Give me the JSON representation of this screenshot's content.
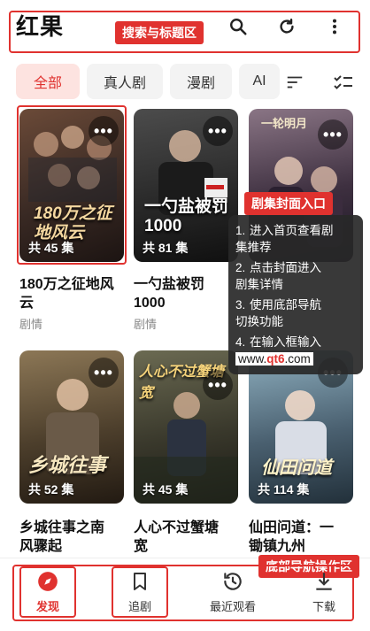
{
  "header": {
    "title": "红果",
    "icons": [
      "search-icon",
      "refresh-icon",
      "more-vertical-icon"
    ],
    "annotation_label": "搜索与标题区"
  },
  "tabs": [
    {
      "label": "全部",
      "active": true
    },
    {
      "label": "真人剧",
      "active": false
    },
    {
      "label": "漫剧",
      "active": false
    },
    {
      "label": "AI",
      "active": false
    }
  ],
  "tab_tools": [
    "sort-icon",
    "multi-select-icon"
  ],
  "cards": [
    {
      "title_line1": "180万之征地风",
      "title_line2": "云",
      "genre": "剧情",
      "episodes": "共 45 集",
      "cover_text": "180万之征地风云",
      "cover_colors": [
        "#5a3b2e",
        "#2a1d1a"
      ],
      "more": "•••"
    },
    {
      "title_line1": "一勺盐被罚",
      "title_line2": "1000",
      "genre": "剧情",
      "episodes": "共 81 集",
      "cover_text": "一勺盐被罚1000",
      "cover_colors": [
        "#3a3a3a",
        "#141414"
      ],
      "more": "•••"
    },
    {
      "title_line1": "",
      "title_line2": "",
      "genre": "",
      "episodes": "",
      "cover_text": "一轮明月",
      "cover_colors": [
        "#6b5a6a",
        "#1d1724"
      ],
      "more": "•••"
    },
    {
      "title_line1": "乡城往事之南",
      "title_line2": "风骤起",
      "genre": "",
      "episodes": "共 52 集",
      "cover_text": "乡城往事",
      "cover_colors": [
        "#7a6a4e",
        "#2d2418"
      ],
      "more": "•••"
    },
    {
      "title_line1": "人心不过蟹塘",
      "title_line2": "宽",
      "genre": "",
      "episodes": "共 45 集",
      "cover_text": "人心不过蟹塘宽",
      "cover_colors": [
        "#4a4a3a",
        "#1e1d18"
      ],
      "more": "•••"
    },
    {
      "title_line1": "仙田问道：一",
      "title_line2": "锄镇九州",
      "genre": "",
      "episodes": "共 114 集",
      "cover_text": "仙田问道",
      "cover_colors": [
        "#6a8a9a",
        "#2a3540"
      ],
      "more": "•••"
    }
  ],
  "cover_annotation_label": "剧集封面入口",
  "tooltip": {
    "items": [
      {
        "num": "1.",
        "line1": "进入首页查看剧",
        "line2": "集推荐"
      },
      {
        "num": "2.",
        "line1": "点击封面进入",
        "line2": "剧集详情"
      },
      {
        "num": "3.",
        "line1": "使用底部导航",
        "line2": "切换功能"
      },
      {
        "num": "4.",
        "line1": "在输入框输入",
        "line2_prefix": "www.",
        "line2_red": "qt6",
        "line2_suffix": ".com"
      }
    ]
  },
  "bottom_nav": {
    "annotation_label": "底部导航操作区",
    "items": [
      {
        "label": "发现",
        "icon": "compass-icon",
        "active": true
      },
      {
        "label": "追剧",
        "icon": "bookmark-icon",
        "active": false
      },
      {
        "label": "最近观看",
        "icon": "history-icon",
        "active": false
      },
      {
        "label": "下载",
        "icon": "download-icon",
        "active": false
      }
    ]
  },
  "colors": {
    "accent": "#e0322f",
    "annotation": "#e0322f",
    "tab_active_bg": "#fde3e0"
  }
}
